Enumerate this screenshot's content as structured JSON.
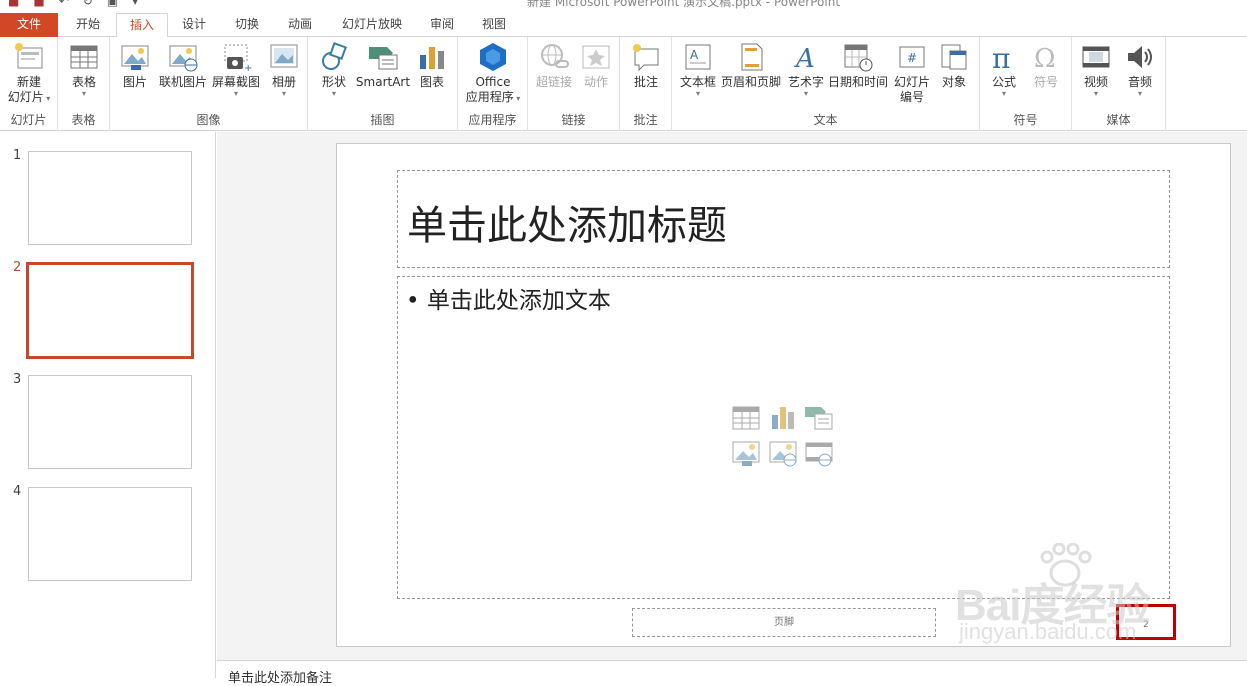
{
  "window": {
    "title": "新建 Microsoft PowerPoint 演示文稿.pptx - PowerPoint"
  },
  "tabs": [
    {
      "label": "文件"
    },
    {
      "label": "开始"
    },
    {
      "label": "插入"
    },
    {
      "label": "设计"
    },
    {
      "label": "切换"
    },
    {
      "label": "动画"
    },
    {
      "label": "幻灯片放映"
    },
    {
      "label": "审阅"
    },
    {
      "label": "视图"
    }
  ],
  "active_tab": "插入",
  "ribbon": {
    "slides": {
      "new_slide_1": "新建",
      "new_slide_2": "幻灯片",
      "label": "幻灯片"
    },
    "tables": {
      "table": "表格",
      "label": "表格"
    },
    "images": {
      "picture": "图片",
      "online_picture": "联机图片",
      "screenshot": "屏幕截图",
      "album": "相册",
      "label": "图像"
    },
    "illustrations": {
      "shapes": "形状",
      "smartart": "SmartArt",
      "chart": "图表",
      "label": "插图"
    },
    "apps": {
      "office_1": "Office",
      "office_2": "应用程序",
      "label": "应用程序"
    },
    "links": {
      "hyperlink": "超链接",
      "action": "动作",
      "label": "链接"
    },
    "comments": {
      "comment": "批注",
      "label": "批注"
    },
    "text": {
      "textbox": "文本框",
      "header_footer": "页眉和页脚",
      "wordart": "艺术字",
      "datetime": "日期和时间",
      "slide_number_1": "幻灯片",
      "slide_number_2": "编号",
      "object": "对象",
      "label": "文本"
    },
    "symbols": {
      "equation": "公式",
      "symbol": "符号",
      "label": "符号"
    },
    "media": {
      "video": "视频",
      "audio": "音频",
      "label": "媒体"
    }
  },
  "thumbnails": [
    {
      "num": "1"
    },
    {
      "num": "2"
    },
    {
      "num": "3"
    },
    {
      "num": "4"
    }
  ],
  "slide": {
    "title_placeholder": "单击此处添加标题",
    "body_placeholder": "• 单击此处添加文本",
    "footer": "页脚",
    "slide_number": "2"
  },
  "notes": {
    "placeholder": "单击此处添加备注"
  },
  "watermark": {
    "text": "Bai度经验",
    "url": "jingyan.baidu.com"
  },
  "colors": {
    "accent": "#d24726",
    "highlight": "#c00000",
    "selected_thumb": "#c4492b"
  }
}
